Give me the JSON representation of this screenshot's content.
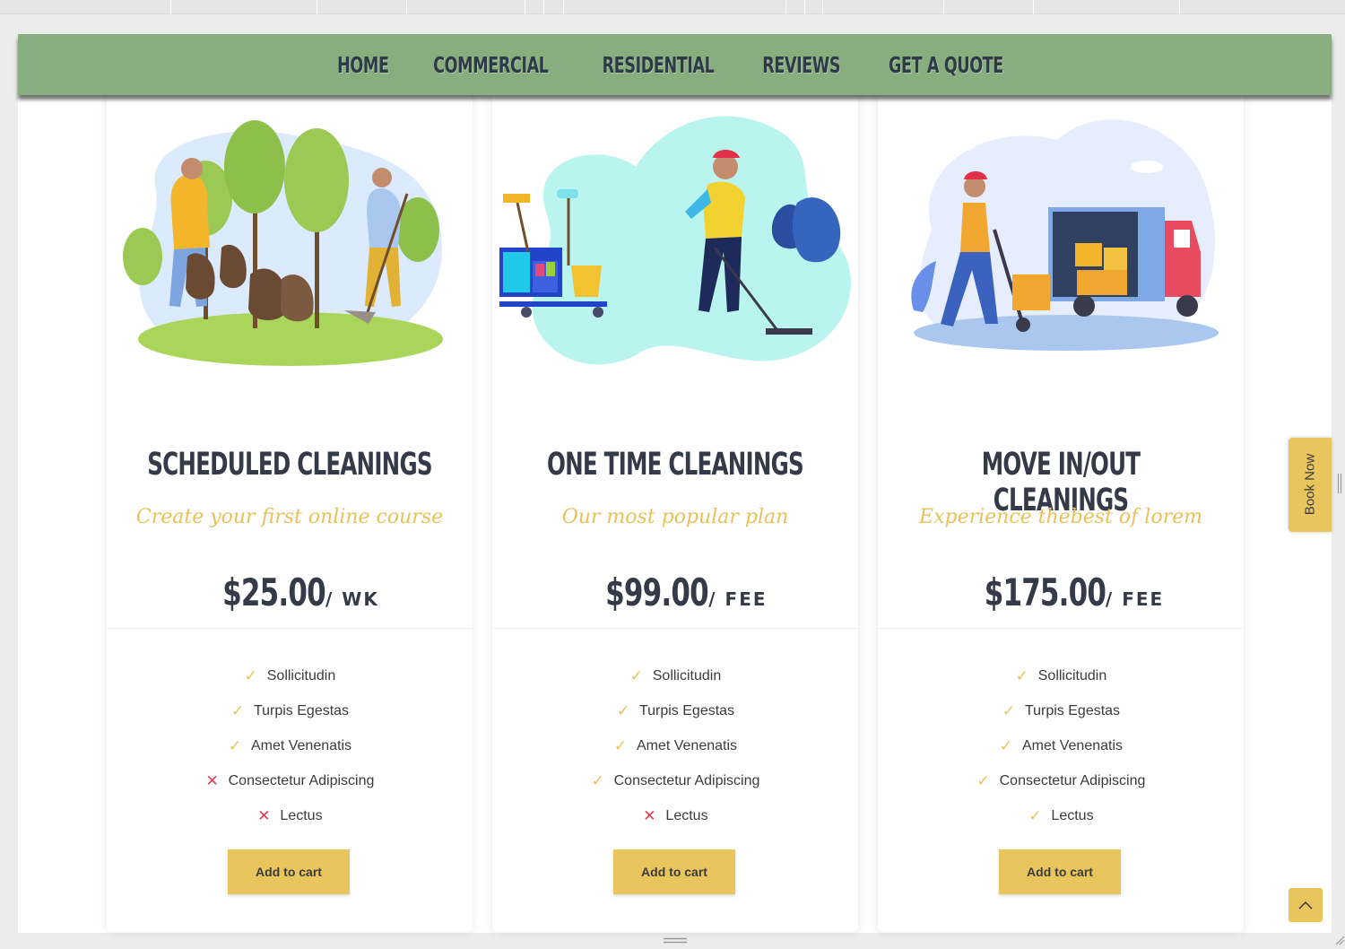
{
  "nav": {
    "items": [
      "HOME",
      "COMMERCIAL",
      "RESIDENTIAL",
      "REVIEWS",
      "GET A QUOTE"
    ]
  },
  "plans": [
    {
      "title": "SCHEDULED CLEANINGS",
      "subtitle": "Create your first online course",
      "price": "$25.00",
      "period": "/ WK",
      "features": [
        {
          "label": "Sollicitudin",
          "included": true
        },
        {
          "label": "Turpis Egestas",
          "included": true
        },
        {
          "label": "Amet Venenatis",
          "included": true
        },
        {
          "label": "Consectetur Adipiscing",
          "included": false
        },
        {
          "label": "Lectus",
          "included": false
        }
      ],
      "button": "Add to cart"
    },
    {
      "title": "ONE TIME CLEANINGS",
      "subtitle": "Our most popular plan",
      "price": "$99.00",
      "period": "/ FEE",
      "features": [
        {
          "label": "Sollicitudin",
          "included": true
        },
        {
          "label": "Turpis Egestas",
          "included": true
        },
        {
          "label": "Amet Venenatis",
          "included": true
        },
        {
          "label": "Consectetur Adipiscing",
          "included": true
        },
        {
          "label": "Lectus",
          "included": false
        }
      ],
      "button": "Add to cart"
    },
    {
      "title": "MOVE IN/OUT CLEANINGS",
      "subtitle": "Experience thebest of lorem",
      "price": "$175.00",
      "period": "/ FEE",
      "features": [
        {
          "label": "Sollicitudin",
          "included": true
        },
        {
          "label": "Turpis Egestas",
          "included": true
        },
        {
          "label": "Amet Venenatis",
          "included": true
        },
        {
          "label": "Consectetur Adipiscing",
          "included": true
        },
        {
          "label": "Lectus",
          "included": true
        }
      ],
      "button": "Add to cart"
    }
  ],
  "book_now": "Book Now",
  "icons": {
    "check": "✓",
    "cross": "✕",
    "scroll_top": "chevron-up-icon"
  },
  "colors": {
    "nav_bg": "#88ad7f",
    "accent": "#e9c55d",
    "subtitle": "#e7c15a",
    "cross": "#e03a4f",
    "heading": "#353a48"
  }
}
